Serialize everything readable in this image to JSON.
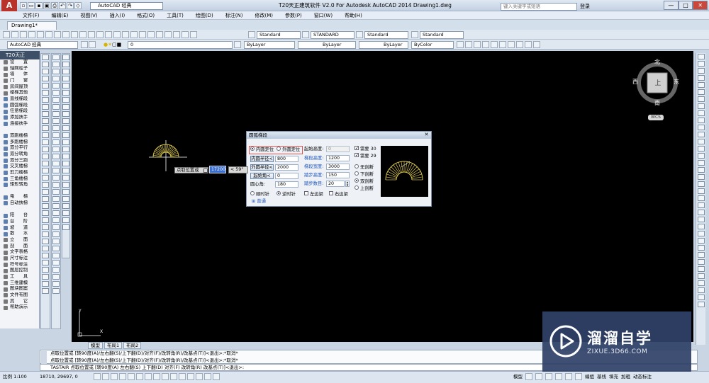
{
  "title_bar": {
    "app_logo": "A",
    "workspace": "AutoCAD 经典",
    "title": "T20天正建筑软件 V2.0 For Autodesk AutoCAD 2014    Drawing1.dwg",
    "search_placeholder": "键入关键字或短语",
    "login": "登录",
    "window_buttons": [
      "—",
      "□",
      "✕"
    ]
  },
  "menu": [
    "文件(F)",
    "编辑(E)",
    "视图(V)",
    "插入(I)",
    "格式(O)",
    "工具(T)",
    "绘图(D)",
    "标注(N)",
    "修改(M)",
    "参数(P)",
    "窗口(W)",
    "帮助(H)"
  ],
  "doc_tab": "Drawing1*",
  "toolbar1": {
    "text_style": "Standard",
    "dim_style": "STANDARD",
    "table_style": "Standard",
    "mleader_style": "Standard"
  },
  "toolbar2": {
    "workspace": "AutoCAD 经典",
    "layer": "0",
    "color": "ByLayer",
    "linetype": "ByLayer",
    "lineweight": "ByLayer",
    "plotstyle": "ByColor"
  },
  "left_panel": {
    "header": "T20天正",
    "items": [
      {
        "label": "设　　置",
        "sec": true
      },
      {
        "label": "轴网柱子",
        "sec": true
      },
      {
        "label": "墙　　体",
        "sec": true
      },
      {
        "label": "门　　窗",
        "sec": true
      },
      {
        "label": "房间屋顶",
        "sec": true
      },
      {
        "label": "楼梯其他",
        "sec": true
      },
      {
        "label": "直线梯段",
        "sec": false
      },
      {
        "label": "圆弧梯段",
        "sec": false
      },
      {
        "label": "任意梯段",
        "sec": false
      },
      {
        "label": "添加扶手",
        "sec": false
      },
      {
        "label": "连接扶手",
        "sec": false
      },
      {
        "label": "",
        "sec": false
      },
      {
        "label": "双跑楼梯",
        "sec": false
      },
      {
        "label": "多跑楼梯",
        "sec": false
      },
      {
        "label": "双分平行",
        "sec": false
      },
      {
        "label": "双分转角",
        "sec": false
      },
      {
        "label": "双分三跑",
        "sec": false
      },
      {
        "label": "交叉楼梯",
        "sec": false
      },
      {
        "label": "剪刀楼梯",
        "sec": false
      },
      {
        "label": "三角楼梯",
        "sec": false
      },
      {
        "label": "矩形转角",
        "sec": false
      },
      {
        "label": "",
        "sec": false
      },
      {
        "label": "电　　梯",
        "sec": false
      },
      {
        "label": "自动扶梯",
        "sec": false
      },
      {
        "label": "",
        "sec": false
      },
      {
        "label": "阳　　台",
        "sec": false
      },
      {
        "label": "台　　阶",
        "sec": false
      },
      {
        "label": "坡　　道",
        "sec": false
      },
      {
        "label": "散　　水",
        "sec": false
      },
      {
        "label": "立　　面",
        "sec": true
      },
      {
        "label": "剖　　面",
        "sec": true
      },
      {
        "label": "文字表格",
        "sec": true
      },
      {
        "label": "尺寸标注",
        "sec": true
      },
      {
        "label": "符号标注",
        "sec": true
      },
      {
        "label": "图层控制",
        "sec": true
      },
      {
        "label": "工　　具",
        "sec": true
      },
      {
        "label": "三维建模",
        "sec": true
      },
      {
        "label": "图块图案",
        "sec": true
      },
      {
        "label": "文件布图",
        "sec": true
      },
      {
        "label": "其　　它",
        "sec": true
      },
      {
        "label": "帮助演示",
        "sec": true
      }
    ]
  },
  "viewcube": {
    "north": "北",
    "south": "南",
    "east": "东",
    "west": "西",
    "face": "上",
    "wcs": "WCS"
  },
  "ucs": {
    "x": "X",
    "y": "Y"
  },
  "layout_tabs": [
    "模型",
    "布局1",
    "布局2"
  ],
  "dialog": {
    "title": "圆弧梯段",
    "close": "✕",
    "inner_pos": "内圆定位",
    "outer_pos": "外圆定位",
    "inner_radius_btn": "内圆半径<",
    "inner_radius": "800",
    "outer_radius_btn": "外圆半径<",
    "outer_radius": "2000",
    "start_angle_btn": "起始角<",
    "start_angle": "0",
    "center_angle_label": "圆心角:",
    "center_angle": "180",
    "start_height_label": "起始高度:",
    "start_height": "0",
    "run_height_label": "梯段高度:",
    "run_height": "1200",
    "run_width_label": "梯段宽度:",
    "run_width": "3000",
    "step_height_label": "踏步高度:",
    "step_height": "150",
    "step_count_label": "踏步数目:",
    "step_count": "20",
    "req1_label": "需要",
    "req1_value": "30",
    "req2_label": "需要",
    "req2_value": "29",
    "cut_options": [
      "无剖断",
      "下剖断",
      "双剖断",
      "上剖断"
    ],
    "cut_selected": 2,
    "dir_cw": "顺时针",
    "dir_ccw": "逆时针",
    "left_edge": "左边梁",
    "right_edge": "右边梁",
    "expand": "⊞",
    "expand_label": "普通"
  },
  "dyn_input": {
    "prompt": "点取位置或",
    "value": "17200",
    "angle": "< 59°"
  },
  "command": {
    "history1": "点取位置或 [转90度(A)/左右翻(S)/上下翻(D)/对齐(F)/改转角(R)/改基点(T)]<退出>:*取消*",
    "history2": "点取位置或 [转90度(A)/左右翻(S)/上下翻(D)/对齐(F)/改转角(R)/改基点(T)]<退出>:*取消*",
    "line": "TASTAIR 点取位置或 [转90度(A) 左右翻(S) 上下翻(D) 对齐(F) 改转角(R) 改基点(T)]<退出>:"
  },
  "status": {
    "scale": "比例 1:100",
    "coords": "18710, 29697, 0",
    "right_items": [
      "模型",
      "编组",
      "基线",
      "填充",
      "加粗",
      "动态标注"
    ]
  },
  "watermark": {
    "brand": "溜溜自学",
    "url": "ZIXUE.3D66.COM"
  }
}
